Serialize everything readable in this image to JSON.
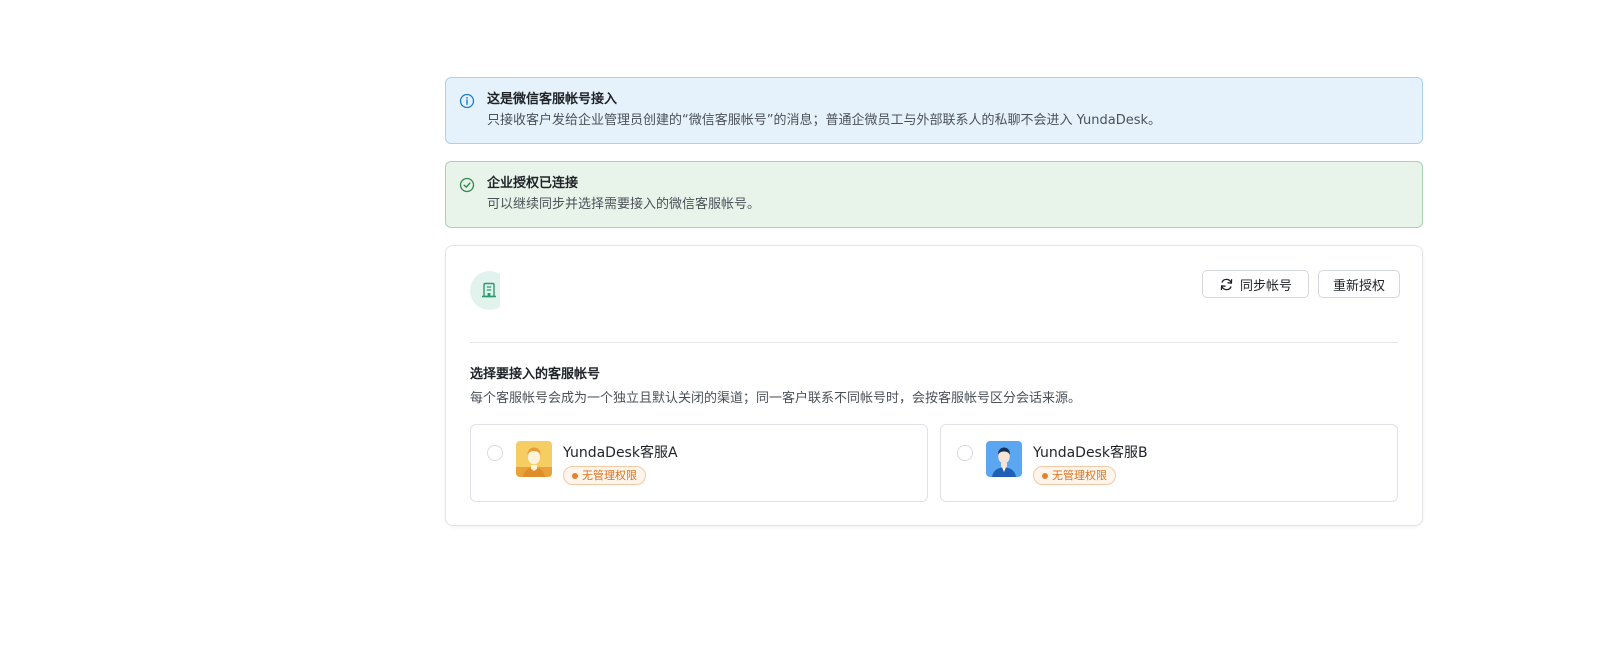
{
  "info_alert": {
    "title": "这是微信客服帐号接入",
    "description": "只接收客户发给企业管理员创建的“微信客服帐号”的消息；普通企微员工与外部联系人的私聊不会进入 YundaDesk。",
    "icon": "info-circle-icon",
    "color": "#1a7fd0"
  },
  "success_alert": {
    "title": "企业授权已连接",
    "description": "可以继续同步并选择需要接入的微信客服帐号。",
    "icon": "check-circle-icon",
    "color": "#2f8a4e"
  },
  "card": {
    "org_icon": "building-icon",
    "sync_button": "同步帐号",
    "reauth_button": "重新授权",
    "section_title": "选择要接入的客服帐号",
    "section_desc": "每个客服帐号会成为一个独立且默认关闭的渠道；同一客户联系不同帐号时，会按客服帐号区分会话来源。",
    "accounts": [
      {
        "name": "YundaDesk客服A",
        "badge": "无管理权限",
        "selected": false,
        "avatar_color": "#f2c14e"
      },
      {
        "name": "YundaDesk客服B",
        "badge": "无管理权限",
        "selected": false,
        "avatar_color": "#3d8fe8"
      }
    ]
  }
}
